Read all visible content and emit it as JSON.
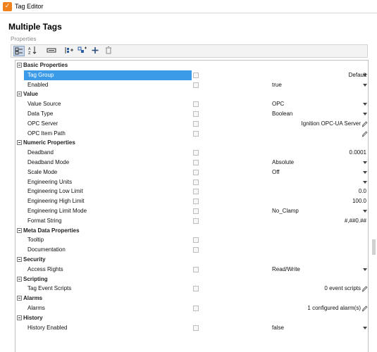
{
  "window": {
    "title": "Tag Editor",
    "icon": "ignition-logo-icon",
    "accent": "#f0821e"
  },
  "dialog": {
    "title": "Multiple Tags",
    "section_label": "Properties"
  },
  "toolbar": {
    "buttons": [
      {
        "name": "categorized-view-icon",
        "active": true
      },
      {
        "name": "sort-alphabetical-icon",
        "active": false
      },
      {
        "name": "show-description-icon",
        "active": false
      },
      {
        "name": "add-member-icon",
        "active": false
      },
      {
        "name": "add-group-icon",
        "active": false
      },
      {
        "name": "add-icon",
        "active": false
      },
      {
        "name": "delete-icon",
        "active": false
      }
    ]
  },
  "selection_color": "#3c9be8",
  "grid": {
    "categories": [
      {
        "label": "Basic Properties",
        "rows": [
          {
            "label": "Tag Group",
            "value": "Default",
            "align": "right",
            "control": "dropdown",
            "selected": true
          },
          {
            "label": "Enabled",
            "value": "true",
            "align": "left",
            "control": "dropdown"
          }
        ]
      },
      {
        "label": "Value",
        "rows": [
          {
            "label": "Value Source",
            "value": "OPC",
            "align": "left",
            "control": "dropdown"
          },
          {
            "label": "Data Type",
            "value": "Boolean",
            "align": "left",
            "control": "dropdown"
          },
          {
            "label": "OPC Server",
            "value": "Ignition OPC-UA Server",
            "align": "right",
            "control": "edit"
          },
          {
            "label": "OPC Item Path",
            "value": "",
            "align": "right",
            "control": "edit"
          }
        ]
      },
      {
        "label": "Numeric Properties",
        "rows": [
          {
            "label": "Deadband",
            "value": "0.0001",
            "align": "right",
            "control": "none"
          },
          {
            "label": "Deadband Mode",
            "value": "Absolute",
            "align": "left",
            "control": "dropdown"
          },
          {
            "label": "Scale Mode",
            "value": "Off",
            "align": "left",
            "control": "dropdown"
          },
          {
            "label": "Engineering Units",
            "value": "",
            "align": "left",
            "control": "dropdown"
          },
          {
            "label": "Engineering Low Limit",
            "value": "0.0",
            "align": "right",
            "control": "none"
          },
          {
            "label": "Engineering High Limit",
            "value": "100.0",
            "align": "right",
            "control": "none"
          },
          {
            "label": "Engineering Limit Mode",
            "value": "No_Clamp",
            "align": "left",
            "control": "dropdown"
          },
          {
            "label": "Format String",
            "value": "#,##0.##",
            "align": "right",
            "control": "none"
          }
        ]
      },
      {
        "label": "Meta Data Properties",
        "rows": [
          {
            "label": "Tooltip",
            "value": "",
            "align": "right",
            "control": "none"
          },
          {
            "label": "Documentation",
            "value": "",
            "align": "right",
            "control": "none"
          }
        ]
      },
      {
        "label": "Security",
        "rows": [
          {
            "label": "Access Rights",
            "value": "Read/Write",
            "align": "left",
            "control": "dropdown"
          }
        ]
      },
      {
        "label": "Scripting",
        "rows": [
          {
            "label": "Tag Event Scripts",
            "value": "0 event scripts",
            "align": "right",
            "control": "edit"
          }
        ]
      },
      {
        "label": "Alarms",
        "rows": [
          {
            "label": "Alarms",
            "value": "1 configured alarm(s)",
            "align": "right",
            "control": "edit"
          }
        ]
      },
      {
        "label": "History",
        "rows": [
          {
            "label": "History Enabled",
            "value": "false",
            "align": "left",
            "control": "dropdown"
          }
        ]
      }
    ]
  }
}
